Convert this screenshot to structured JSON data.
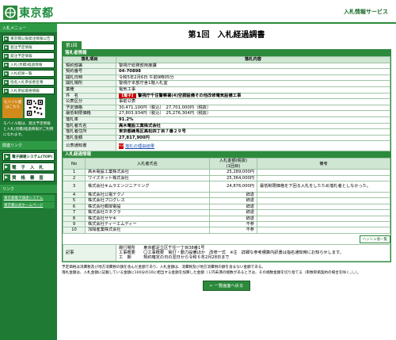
{
  "header": {
    "logo_text": "東京都",
    "service_name": "入札情報サービス"
  },
  "sidebar": {
    "menu_heading": "入札メニュー",
    "items": [
      {
        "label": "東京都公報発注情報公告"
      },
      {
        "label": "発注予定情報"
      },
      {
        "label": "発注予定情報"
      },
      {
        "label": "入札(見積)経過情報"
      },
      {
        "label": "入札結果一覧"
      },
      {
        "label": "指名入札参加者名簿"
      },
      {
        "label": "入札参加資格情報"
      }
    ],
    "mobile_label": "モバイル版はこちら",
    "mobile_desc": "モバイル版は、発注予定情報と入札(見積)経過情報がご利用になれます。",
    "link_heading": "関連リンク",
    "big_buttons": [
      {
        "label": "電子調達システム(TOP)"
      },
      {
        "label": "電 子 入 札"
      },
      {
        "label": "資 格 審 査"
      }
    ],
    "link_heading2": "リンク",
    "links": [
      {
        "label": "東京都電子調達システム"
      },
      {
        "label": "東京都公式ホームページ"
      }
    ]
  },
  "main": {
    "title": "第1回　入札経過調書",
    "tab_label": "第1回",
    "section1_title": "落札者情報",
    "section1_header": [
      "落札項目",
      "落札内容"
    ],
    "info_rows": [
      {
        "label": "契約部署",
        "value": "警視庁総務部用度課"
      },
      {
        "label": "契約番号",
        "value": "04-70898"
      },
      {
        "label": "開札日時",
        "value": "令和5年2月6日 午前9時05分"
      },
      {
        "label": "開札場所",
        "value": "警視庁本部庁舎1階入札室"
      },
      {
        "label": "業種",
        "value": "電気工事"
      }
    ],
    "subject": {
      "label": "件　名",
      "badge": "【電子】",
      "value": "警視庁千住警察署(4)空調設備その他改修電気設備工事"
    },
    "info_rows2": [
      {
        "label": "公表区分",
        "value": "事前公表"
      },
      {
        "label": "予定価格",
        "value": "30,471,100円（税込）　27,701,000円（税抜）"
      },
      {
        "label": "最低制限価格",
        "value": "27,803,934円（税込）　25,276,304円（税抜）"
      },
      {
        "label": "落札率",
        "value": "91.2%"
      },
      {
        "label": "落札者氏名",
        "value": "高木電設工業株式会社"
      },
      {
        "label": "落札者住所",
        "value": "東京都練馬区高松四丁目７番２９号"
      },
      {
        "label": "落札金額",
        "value": "27,817,900円"
      }
    ],
    "notice": {
      "label": "公表通知書",
      "link": "落札の理由結果"
    },
    "section2_title": "入札経過情報",
    "bid_header": [
      "No",
      "入札者氏名",
      "入札金額(税抜)",
      "備考"
    ],
    "bid_header_sub": "(1回目)",
    "bids": [
      {
        "no": "1",
        "name": "高木電設工業株式会社",
        "amount": "25,289,000円",
        "remark": ""
      },
      {
        "no": "2",
        "name": "ワイズネット株式会社",
        "amount": "25,364,000円",
        "remark": ""
      },
      {
        "no": "3",
        "name": "株式会社キムラエンジニアリング",
        "amount": "24,876,000円",
        "remark": "最低制限価格を下回る入札をしたため落札者としなかった。"
      },
      {
        "no": "4",
        "name": "株式会社公電テクノ",
        "amount": "辞退",
        "remark": ""
      },
      {
        "no": "5",
        "name": "株式会社プログレス",
        "amount": "辞退",
        "remark": ""
      },
      {
        "no": "6",
        "name": "株式会社郷岸電設",
        "amount": "辞退",
        "remark": ""
      },
      {
        "no": "7",
        "name": "株式会社カネクラ",
        "amount": "辞退",
        "remark": ""
      },
      {
        "no": "8",
        "name": "株式会社サヤキ",
        "amount": "辞退",
        "remark": ""
      },
      {
        "no": "9",
        "name": "株式会社ティーエムディー",
        "amount": "不参",
        "remark": ""
      },
      {
        "no": "10",
        "name": "加陽産業株式会社",
        "amount": "不参",
        "remark": ""
      }
    ],
    "hash_button": "ハッシュ値一覧",
    "notes_label": "記事",
    "notes_lines": [
      "履行場所　　東京都足立区千住一丁目38番1号",
      "工事概要　　〇工事概要　電灯・動力設備ほか　改修一式　※注　詳細な参考積算内訳書は指名通知時にお知らせします。",
      "工　期　　　契約確定の日の翌日から令和６年2月28日まで"
    ],
    "footnote1": "予定価格は消費税及び地方消費税の額を含んだ金額であり、入札金額は、消費税及び地方消費税の額を含まない金額である。",
    "footnote2": "落札金額は、入札金額に記載している金額に100分の10に相当する金額を加算した金額（１円未満の端数があるときは、その端数金額を切り捨てる（単数単価契約の場合を除く。）。）。",
    "back_button": "← 一覧画面へ戻る"
  },
  "colors": {
    "brand_green": "#2c8a3c",
    "sidebar_green": "#1f7a34",
    "mobile_orange": "#d28a1a",
    "badge_red": "#cc0000"
  }
}
